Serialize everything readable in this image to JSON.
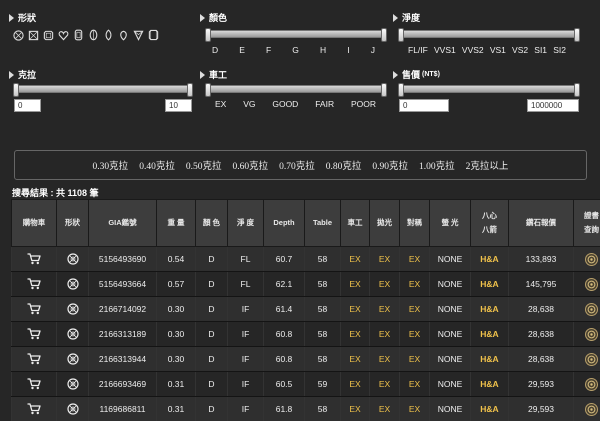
{
  "filters": {
    "shape": {
      "title": "形狀",
      "icons": [
        "round-shape-icon",
        "princess-shape-icon",
        "emerald-shape-icon",
        "heart-shape-icon",
        "oval-shape-icon",
        "cushion-shape-icon",
        "marquise-shape-icon",
        "pear-shape-icon",
        "trillion-shape-icon",
        "radiant-shape-icon"
      ]
    },
    "color": {
      "title": "顏色",
      "ticks": [
        "D",
        "E",
        "F",
        "G",
        "H",
        "I",
        "J"
      ]
    },
    "clarity": {
      "title": "淨度",
      "ticks": [
        "FL/IF",
        "VVS1",
        "VVS2",
        "VS1",
        "VS2",
        "SI1",
        "SI2"
      ]
    },
    "carat": {
      "title": "克拉",
      "min_value": "0",
      "max_value": "10"
    },
    "cut": {
      "title": "車工",
      "ticks": [
        "EX",
        "VG",
        "GOOD",
        "FAIR",
        "POOR"
      ]
    },
    "price": {
      "title": "售價",
      "unit": "(NT$)",
      "min_value": "0",
      "max_value": "1000000"
    }
  },
  "carat_quick": [
    "0.30克拉",
    "0.40克拉",
    "0.50克拉",
    "0.60克拉",
    "0.70克拉",
    "0.80克拉",
    "0.90克拉",
    "1.00克拉",
    "2克拉以上"
  ],
  "result": {
    "text": "搜尋結果 : 共 1108 筆"
  },
  "table": {
    "headers": {
      "cart": "購物車",
      "shape": "形狀",
      "gia": "GIA鑑號",
      "weight": "重 量",
      "color": "顏 色",
      "clarity": "淨 度",
      "depth": "Depth",
      "table": "Table",
      "cut": "車工",
      "polish": "拋光",
      "symmetry": "對稱",
      "fluor": "螢 光",
      "ha_1": "八心",
      "ha_2": "八箭",
      "price": "鑽石報價",
      "cert_1": "證書",
      "cert_2": "查詢"
    },
    "rows": [
      {
        "gia": "5156493690",
        "weight": "0.54",
        "color": "D",
        "clarity": "FL",
        "depth": "60.7",
        "table": "58",
        "cut": "EX",
        "polish": "EX",
        "symmetry": "EX",
        "fluor": "NONE",
        "ha": "H&A",
        "price": "133,893"
      },
      {
        "gia": "5156493664",
        "weight": "0.57",
        "color": "D",
        "clarity": "FL",
        "depth": "62.1",
        "table": "58",
        "cut": "EX",
        "polish": "EX",
        "symmetry": "EX",
        "fluor": "NONE",
        "ha": "H&A",
        "price": "145,795"
      },
      {
        "gia": "2166714092",
        "weight": "0.30",
        "color": "D",
        "clarity": "IF",
        "depth": "61.4",
        "table": "58",
        "cut": "EX",
        "polish": "EX",
        "symmetry": "EX",
        "fluor": "NONE",
        "ha": "H&A",
        "price": "28,638"
      },
      {
        "gia": "2166313189",
        "weight": "0.30",
        "color": "D",
        "clarity": "IF",
        "depth": "60.8",
        "table": "58",
        "cut": "EX",
        "polish": "EX",
        "symmetry": "EX",
        "fluor": "NONE",
        "ha": "H&A",
        "price": "28,638"
      },
      {
        "gia": "2166313944",
        "weight": "0.30",
        "color": "D",
        "clarity": "IF",
        "depth": "60.8",
        "table": "58",
        "cut": "EX",
        "polish": "EX",
        "symmetry": "EX",
        "fluor": "NONE",
        "ha": "H&A",
        "price": "28,638"
      },
      {
        "gia": "2166693469",
        "weight": "0.31",
        "color": "D",
        "clarity": "IF",
        "depth": "60.5",
        "table": "59",
        "cut": "EX",
        "polish": "EX",
        "symmetry": "EX",
        "fluor": "NONE",
        "ha": "H&A",
        "price": "29,593"
      },
      {
        "gia": "1169686811",
        "weight": "0.31",
        "color": "D",
        "clarity": "IF",
        "depth": "61.8",
        "table": "58",
        "cut": "EX",
        "polish": "EX",
        "symmetry": "EX",
        "fluor": "NONE",
        "ha": "H&A",
        "price": "29,593"
      }
    ]
  },
  "icons": {
    "cart": "shopping-cart-icon",
    "row_shape": "round-brilliant-icon",
    "cert": "certificate-icon"
  }
}
